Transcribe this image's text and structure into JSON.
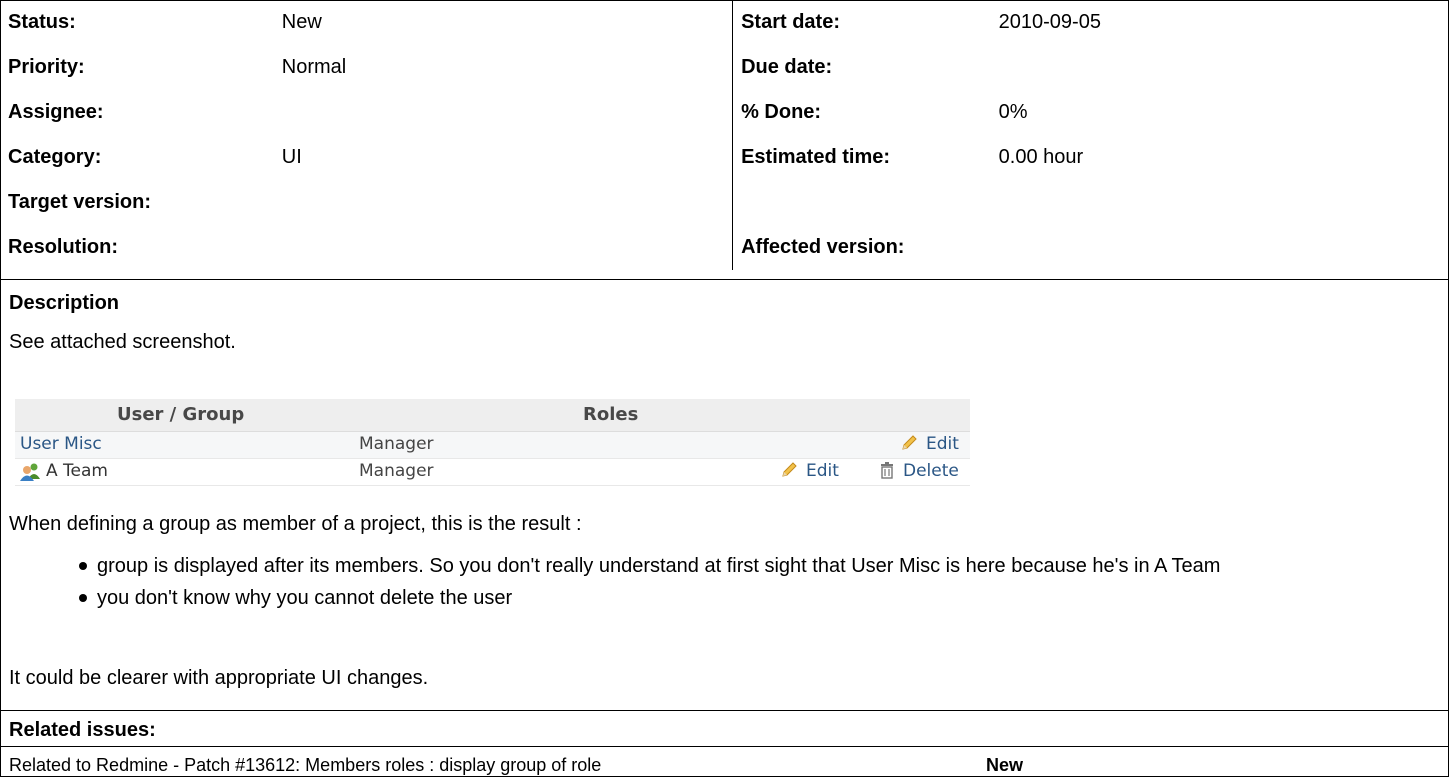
{
  "attributes": {
    "left": [
      {
        "label": "Status:",
        "value": "New"
      },
      {
        "label": "Priority:",
        "value": "Normal"
      },
      {
        "label": "Assignee:",
        "value": ""
      },
      {
        "label": "Category:",
        "value": "UI"
      },
      {
        "label": "Target version:",
        "value": ""
      },
      {
        "label": "Resolution:",
        "value": ""
      }
    ],
    "right": [
      {
        "label": "Start date:",
        "value": "2010-09-05"
      },
      {
        "label": "Due date:",
        "value": ""
      },
      {
        "label": "% Done:",
        "value": "0%"
      },
      {
        "label": "Estimated time:",
        "value": "0.00 hour"
      },
      {
        "label": "",
        "value": ""
      },
      {
        "label": "Affected version:",
        "value": ""
      }
    ]
  },
  "description": {
    "title": "Description",
    "intro": "See attached screenshot.",
    "screenshot": {
      "col_user": "User / Group",
      "col_roles": "Roles",
      "rows": [
        {
          "name": "User Misc",
          "role": "Manager",
          "edit": "Edit",
          "delete": ""
        },
        {
          "name": "A Team",
          "role": "Manager",
          "edit": "Edit",
          "delete": "Delete"
        }
      ]
    },
    "para2": "When defining a group as member of a project, this is the result :",
    "bullets": [
      "group is displayed after its members. So you don't really understand at first sight that User Misc is here because he's in A Team",
      "you don't know why you cannot delete the user"
    ],
    "para3": "It could be clearer with appropriate UI changes."
  },
  "related": {
    "title": "Related issues:",
    "items": [
      {
        "text": "Related to Redmine - Patch #13612: Members roles : display group of role",
        "status": "New"
      }
    ]
  }
}
